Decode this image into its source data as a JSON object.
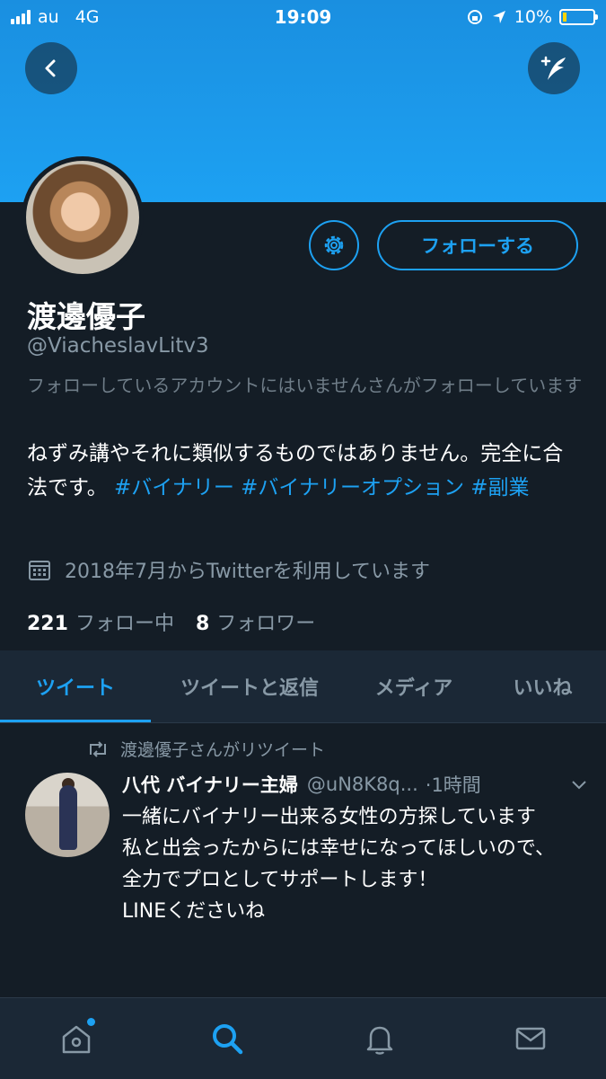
{
  "status_bar": {
    "carrier": "au",
    "network": "4G",
    "time": "19:09",
    "battery": "10%"
  },
  "colors": {
    "accent": "#1da1f2",
    "background": "#141d26",
    "banner": "#1da1f2",
    "muted": "#8899a6"
  },
  "header": {
    "back_icon": "chevron-left-icon",
    "compose_icon": "compose-feather-icon"
  },
  "profile": {
    "display_name": "渡邊優子",
    "handle": "@ViacheslavLitv3",
    "follow_label": "フォローする",
    "settings_icon": "gear-icon",
    "follow_context": "フォローしているアカウントにはいませんさんがフォローしています",
    "bio_text": "ねずみ講やそれに類似するものではありません。完全に合法です。",
    "bio_hashtags": [
      "#バイナリー",
      "#バイナリーオプション",
      "#副業"
    ],
    "joined": "2018年7月からTwitterを利用しています",
    "following_count": "221",
    "following_label": "フォロー中",
    "followers_count": "8",
    "followers_label": "フォロワー"
  },
  "tabs": [
    {
      "label": "ツイート",
      "active": true
    },
    {
      "label": "ツイートと返信",
      "active": false
    },
    {
      "label": "メディア",
      "active": false
    },
    {
      "label": "いいね",
      "active": false
    }
  ],
  "tweet": {
    "retweet_context": "渡邊優子さんがリツイート",
    "author_name": "八代 バイナリー主婦",
    "author_handle": "@uN8K8q...",
    "time": "·1時間",
    "body": "一緒にバイナリー出来る女性の方探しています\n私と出会ったからには幸せになってほしいので、\n全力でプロとしてサポートします！\nLINEくださいね"
  },
  "bottom_nav": [
    {
      "icon": "home-icon",
      "has_notification": true
    },
    {
      "icon": "search-icon",
      "active": true
    },
    {
      "icon": "bell-icon"
    },
    {
      "icon": "mail-icon"
    }
  ]
}
